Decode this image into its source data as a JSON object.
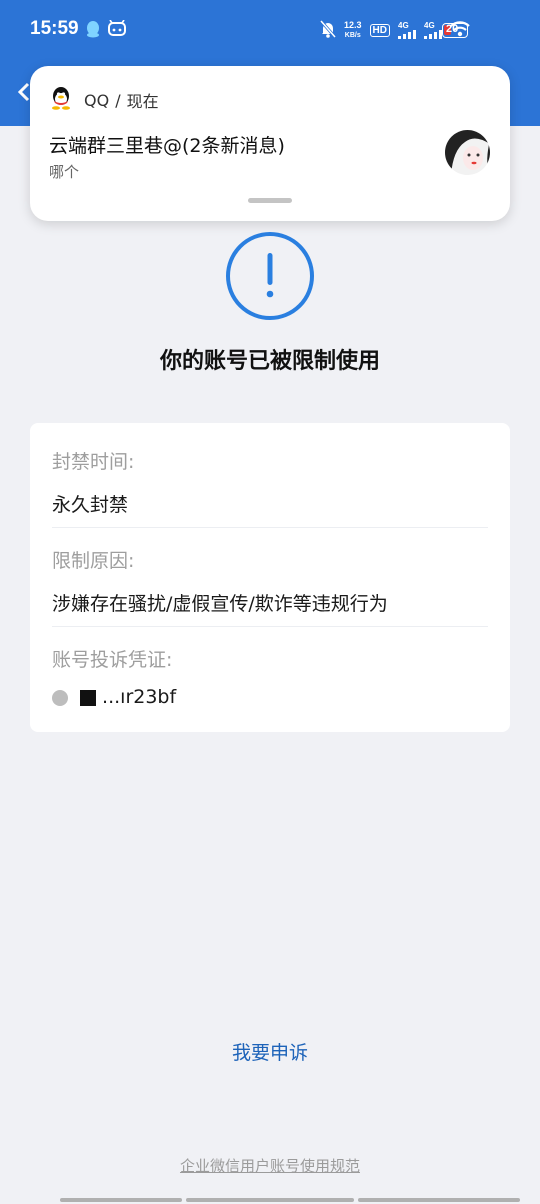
{
  "status_bar": {
    "time": "15:59",
    "net_speed_value": "12.3",
    "net_speed_unit": "KB/s",
    "hd_label": "HD",
    "signal1_label": "4G",
    "signal2_label": "4G",
    "battery": "20",
    "icons": [
      "qq-status-icon",
      "android-app-icon",
      "mute-bell-icon",
      "hd-icon",
      "signal-4g-icon",
      "signal-4g-icon",
      "wifi-icon",
      "battery-icon"
    ]
  },
  "notification": {
    "app_name": "QQ",
    "separator": "/",
    "time": "现在",
    "title": "云端群三里巷@(2条新消息)",
    "body": "哪个"
  },
  "page": {
    "headline": "你的账号已被限制使用",
    "fields": [
      {
        "label": "封禁时间:",
        "value": "永久封禁"
      },
      {
        "label": "限制原因:",
        "value": "涉嫌存在骚扰/虚假宣传/欺诈等违规行为"
      },
      {
        "label": "账号投诉凭证:",
        "value": "...ır23bf"
      }
    ],
    "appeal_link": "我要申诉",
    "rules_link": "企业微信用户账号使用规范"
  },
  "colors": {
    "header_blue": "#2c74d6",
    "alert_blue": "#2a7fe0",
    "link_blue": "#1d63b9",
    "page_bg": "#f0f1f5",
    "battery_low_red": "#e53935"
  }
}
